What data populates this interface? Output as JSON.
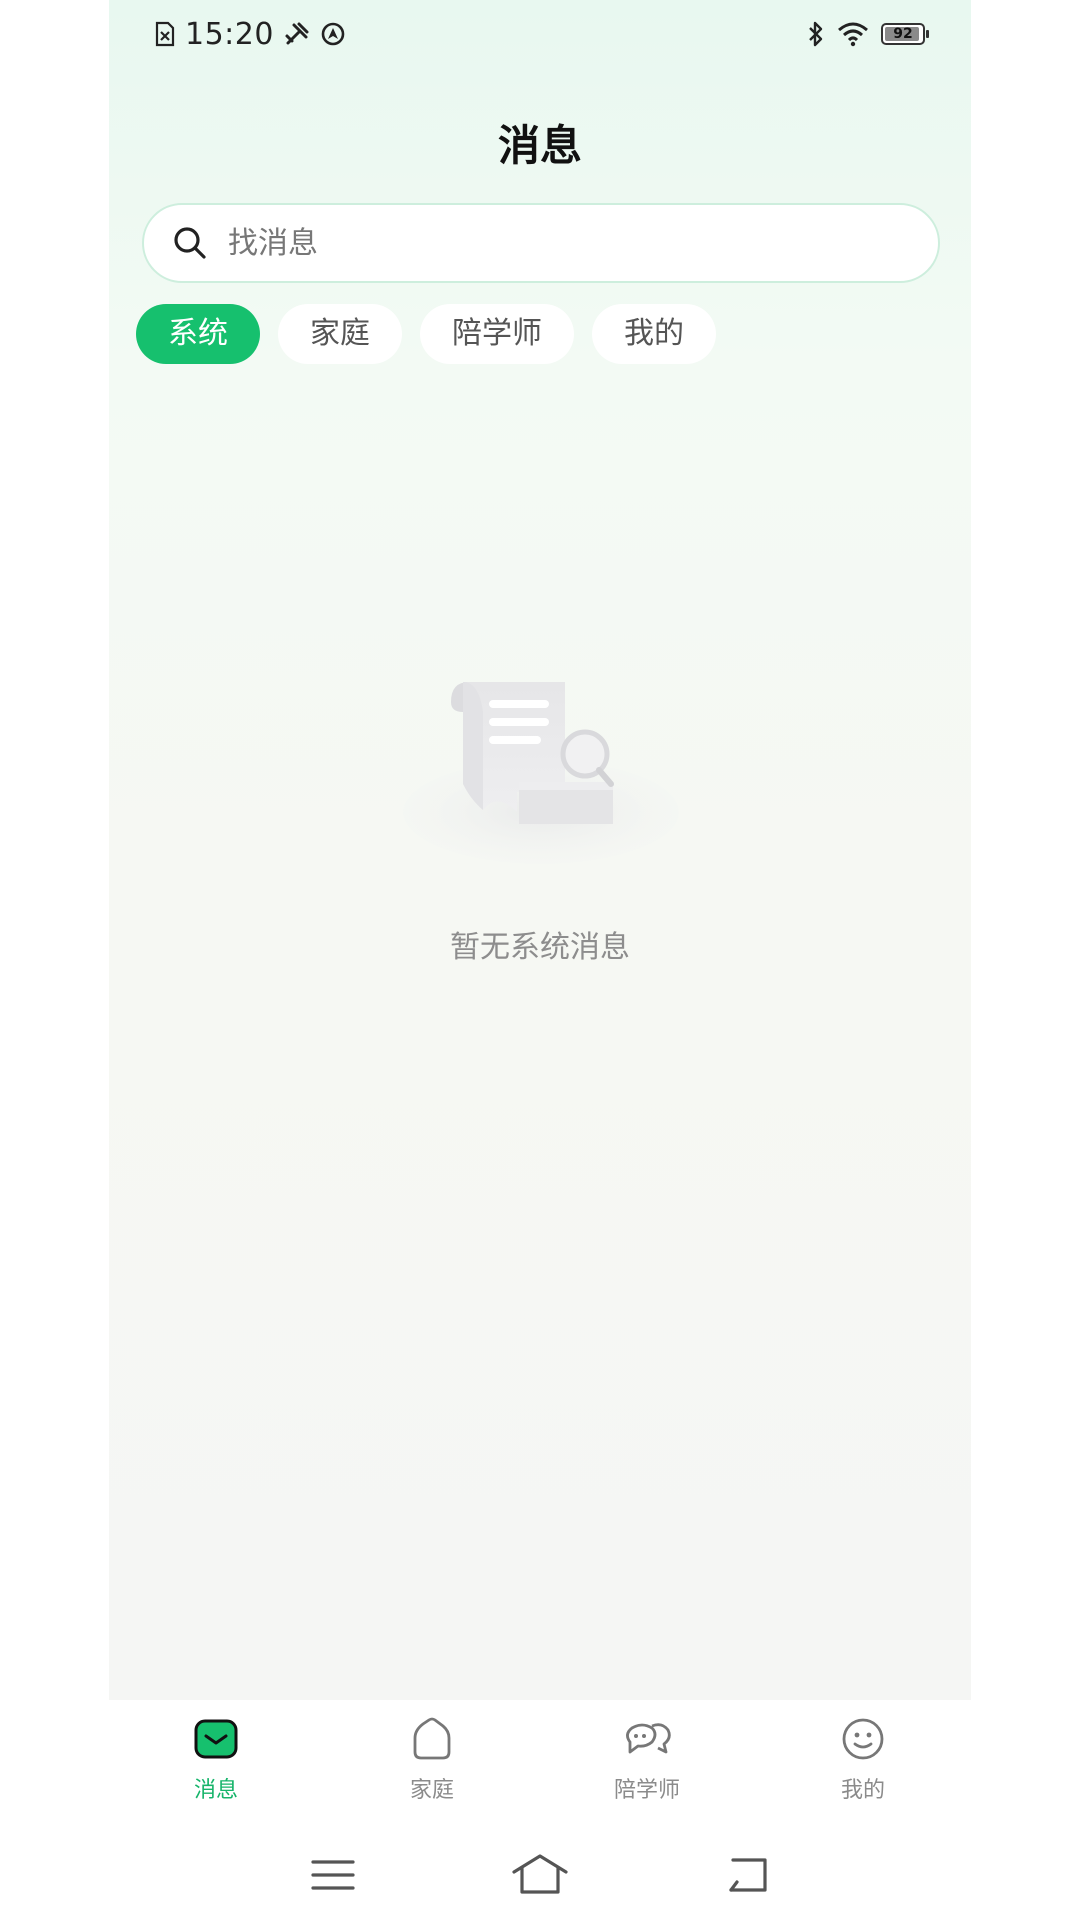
{
  "status_bar": {
    "time": "15:20",
    "battery_level": "92",
    "icons": [
      "sim-off-icon",
      "tools-icon",
      "location-icon",
      "bluetooth-icon",
      "wifi-icon",
      "battery-icon"
    ]
  },
  "header": {
    "title": "消息"
  },
  "search": {
    "placeholder": "找消息",
    "value": ""
  },
  "tabs": [
    {
      "label": "系统",
      "active": true
    },
    {
      "label": "家庭",
      "active": false
    },
    {
      "label": "陪学师",
      "active": false
    },
    {
      "label": "我的",
      "active": false
    }
  ],
  "empty_state": {
    "message": "暂无系统消息",
    "icon": "empty-document-search-icon"
  },
  "bottom_nav": [
    {
      "label": "消息",
      "icon": "message-icon",
      "active": true
    },
    {
      "label": "家庭",
      "icon": "home-icon",
      "active": false
    },
    {
      "label": "陪学师",
      "icon": "chat-bubbles-icon",
      "active": false
    },
    {
      "label": "我的",
      "icon": "smile-face-icon",
      "active": false
    }
  ],
  "system_nav": [
    "menu-icon",
    "home-outline-icon",
    "back-icon"
  ],
  "colors": {
    "accent": "#16c06e",
    "active_nav_text": "#16b46a",
    "inactive_text": "#8b8b8b"
  }
}
